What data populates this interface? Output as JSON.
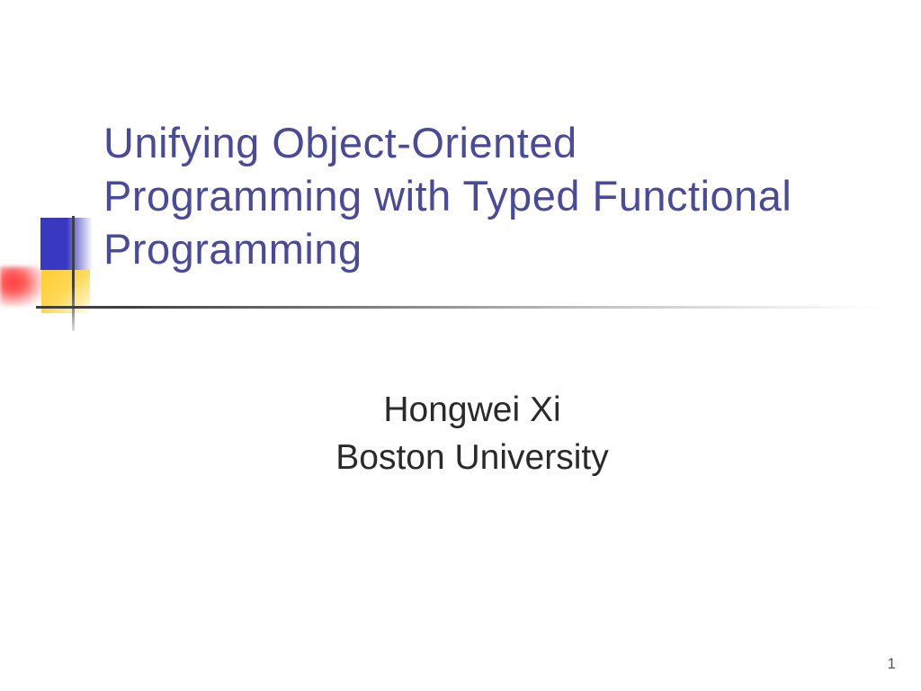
{
  "slide": {
    "title": "Unifying Object-Oriented Programming with Typed Functional Programming",
    "author": "Hongwei Xi",
    "affiliation": "Boston University",
    "pageNumber": "1"
  }
}
